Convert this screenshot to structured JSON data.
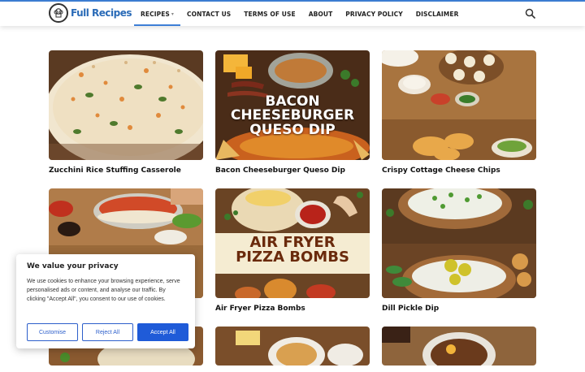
{
  "header": {
    "logo_text": "Full Recipes",
    "nav": [
      {
        "label": "RECIPES",
        "active": true,
        "has_dropdown": true
      },
      {
        "label": "CONTACT US"
      },
      {
        "label": "TERMS OF USE"
      },
      {
        "label": "ABOUT"
      },
      {
        "label": "PRIVACY POLICY"
      },
      {
        "label": "DISCLAIMER"
      }
    ],
    "search_icon": "search-icon",
    "accent_color": "#3d7fd6"
  },
  "recipes": [
    {
      "title": "Zucchini Rice Stuffing Casserole"
    },
    {
      "title": "Bacon Cheeseburger Queso Dip",
      "image_text": [
        "BACON",
        "CHEESEBURGER",
        "QUESO DIP"
      ]
    },
    {
      "title": "Crispy Cottage Cheese Chips"
    },
    {
      "title": ""
    },
    {
      "title": "Air Fryer Pizza Bombs",
      "image_text": [
        "AIR FRYER",
        "PIZZA BOMBS"
      ]
    },
    {
      "title": "Dill Pickle Dip"
    },
    {
      "title": ""
    },
    {
      "title": ""
    },
    {
      "title": ""
    }
  ],
  "cookie_banner": {
    "title": "We value your privacy",
    "text": "We use cookies to enhance your browsing experience, serve personalised ads or content, and analyse our traffic. By clicking \"Accept All\", you consent to our use of cookies.",
    "customise_label": "Customise",
    "reject_label": "Reject All",
    "accept_label": "Accept All",
    "button_color": "#1f5bd8"
  }
}
